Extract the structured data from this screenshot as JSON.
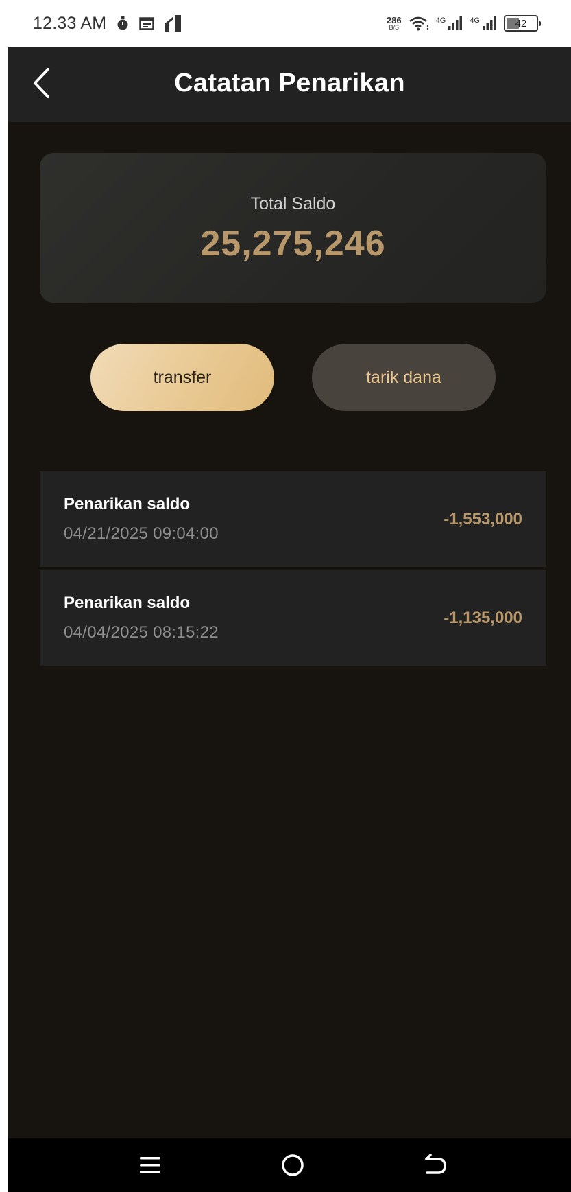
{
  "status_bar": {
    "time": "12.33 AM",
    "net_speed_value": "286",
    "net_speed_unit": "B/S",
    "sig1_label": "4G",
    "sig2_label": "4G",
    "battery": "42",
    "icons": [
      "stopwatch-icon",
      "calendar-icon",
      "signal-strip-icon",
      "wifi-icon",
      "signal-icon",
      "battery-icon"
    ]
  },
  "header": {
    "title": "Catatan Penarikan",
    "back_icon": "chevron-left-icon"
  },
  "balance": {
    "label": "Total Saldo",
    "value": "25,275,246"
  },
  "actions": {
    "transfer_label": "transfer",
    "withdraw_label": "tarik dana"
  },
  "transactions": [
    {
      "title": "Penarikan saldo",
      "date": "04/21/2025 09:04:00",
      "amount": "-1,553,000"
    },
    {
      "title": "Penarikan saldo",
      "date": "04/04/2025 08:15:22",
      "amount": "-1,135,000"
    }
  ],
  "nav_bar": {
    "icons": [
      "menu-icon",
      "home-icon",
      "back-icon"
    ]
  },
  "colors": {
    "background": "#17140f",
    "header": "#222222",
    "gold": "#b8986a",
    "transfer_button": "#e9c993",
    "withdraw_button": "#48433c"
  }
}
